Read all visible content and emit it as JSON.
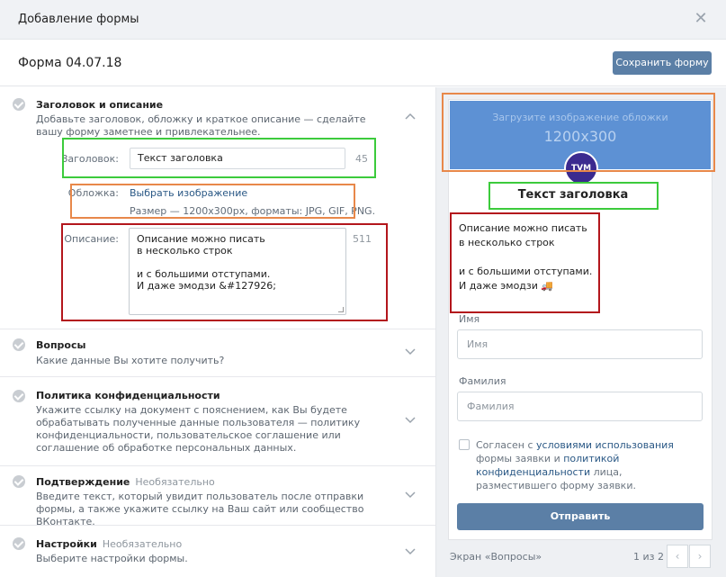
{
  "modal": {
    "title": "Добавление формы",
    "close": "✕"
  },
  "form_bar": {
    "name": "Форма 04.07.18",
    "save_label": "Сохранить форму"
  },
  "sections": {
    "header": {
      "title": "Заголовок и описание",
      "desc": "Добавьте заголовок, обложку и краткое описание — сделайте вашу форму заметнее и привлекательнее.",
      "title_label": "Заголовок:",
      "title_value": "Текст заголовка",
      "title_counter": "45",
      "cover_label": "Обложка:",
      "cover_link": "Выбрать изображение",
      "cover_hint": "Размер — 1200x300px, форматы: JPG, GIF, PNG.",
      "desc_label": "Описание:",
      "desc_value": "Описание можно писать\nв несколько строк\n\nи с большими отступами.\nИ даже эмодзи &#127926;",
      "desc_counter": "511"
    },
    "questions": {
      "title": "Вопросы",
      "desc": "Какие данные Вы хотите получить?"
    },
    "privacy": {
      "title": "Политика конфиденциальности",
      "desc": "Укажите ссылку на документ с пояснением, как Вы будете обрабатывать полученные данные пользователя — политику конфиденциальности, пользовательское соглашение или соглашение об обработке персональных данных."
    },
    "confirm": {
      "title": "Подтверждение",
      "optional": "Необязательно",
      "desc": "Введите текст, который увидит пользователь после отправки формы, а также укажите ссылку на Ваш сайт или сообщество ВКонтакте."
    },
    "settings": {
      "title": "Настройки",
      "optional": "Необязательно",
      "desc": "Выберите настройки формы."
    }
  },
  "preview": {
    "cover_line1": "Загрузите изображение обложки",
    "cover_line2": "1200x300",
    "avatar_text": "TVM",
    "title": "Текст заголовка",
    "desc": "Описание можно писать\nв несколько строк\n\nи с большими отступами.\nИ даже эмодзи",
    "emoji": "🚚",
    "name_label": "Имя",
    "name_placeholder": "Имя",
    "surname_label": "Фамилия",
    "surname_placeholder": "Фамилия",
    "consent_pre": "Согласен с ",
    "consent_link1": "условиями использования",
    "consent_mid1": " формы заявки и ",
    "consent_link2": "политикой конфиденциальности",
    "consent_post": " лица, разместившего форму заявки.",
    "submit": "Отправить",
    "footer_screen": "Экран «Вопросы»",
    "footer_pages": "1 из 2",
    "prev": "‹",
    "next": "›"
  },
  "colors": {
    "accent": "#5b7fa6",
    "cover": "#5d91d4",
    "hl_green": "#3ccb3c",
    "hl_orange": "#e8884a",
    "hl_red": "#b3161c"
  }
}
